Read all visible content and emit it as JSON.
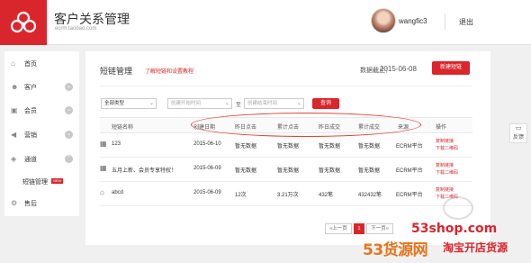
{
  "header": {
    "title": "客户关系管理",
    "url": "ecrm.taobao.com",
    "username": "wangfic3",
    "logout_label": "退出"
  },
  "sidebar": {
    "items": [
      {
        "label": "首页",
        "icon": "home-icon"
      },
      {
        "label": "客户",
        "icon": "user-icon"
      },
      {
        "label": "会员",
        "icon": "member-card-icon"
      },
      {
        "label": "营销",
        "icon": "megaphone-icon"
      },
      {
        "label": "通道",
        "icon": "channel-icon"
      },
      {
        "label": "短链管理",
        "badge": "NEW"
      },
      {
        "label": "售后",
        "icon": "service-icon"
      }
    ]
  },
  "main": {
    "title": "短链管理",
    "help_link": "了解短链和设置教程",
    "date_label": "数据截止：",
    "date_value": "2015-06-08",
    "new_button": "新建短链"
  },
  "filters": {
    "type_value": "全部类型",
    "start_placeholder": "创建开始时间",
    "to_label": "至",
    "end_placeholder": "创建结束时间",
    "query_button": "查询"
  },
  "table": {
    "headers": [
      "短链名称",
      "创建日期",
      "昨日点击",
      "累计点击",
      "昨日成交",
      "累计成交",
      "来源",
      "操作"
    ],
    "rows": [
      {
        "icon": "calendar-icon",
        "name": "123",
        "date": "2015-06-10",
        "y_click": "暂无数据",
        "t_click": "暂无数据",
        "y_deal": "暂无数据",
        "t_deal": "暂无数据",
        "source": "ECRM平台",
        "op1": "复制链接",
        "op2": "下载二维码"
      },
      {
        "icon": "calendar-icon",
        "name": "五月上新、会员专享特权！",
        "date": "2015-06-09",
        "y_click": "暂无数据",
        "t_click": "暂无数据",
        "y_deal": "暂无数据",
        "t_deal": "暂无数据",
        "source": "ECRM平台",
        "op1": "复制链接",
        "op2": "下载二维码"
      },
      {
        "icon": "home-icon",
        "name": "abcd",
        "date": "2015-06-09",
        "y_click": "12次",
        "t_click": "3.21万次",
        "y_deal": "432笔",
        "t_deal": "432432笔",
        "source": "ECRM平台",
        "op1": "复制链接",
        "op2": "下载二维码"
      }
    ]
  },
  "pagination": {
    "prev": "«上一页",
    "current": "1",
    "next": "下一页»"
  },
  "feedback_label": "反馈",
  "watermark": {
    "site": "53shop.com",
    "brand": "53货源网",
    "slogan": "淘宝开店货源"
  },
  "colors": {
    "brand_red": "#d9262c",
    "annotation_red": "#e0453c",
    "watermark_orange": "#e8731c"
  }
}
